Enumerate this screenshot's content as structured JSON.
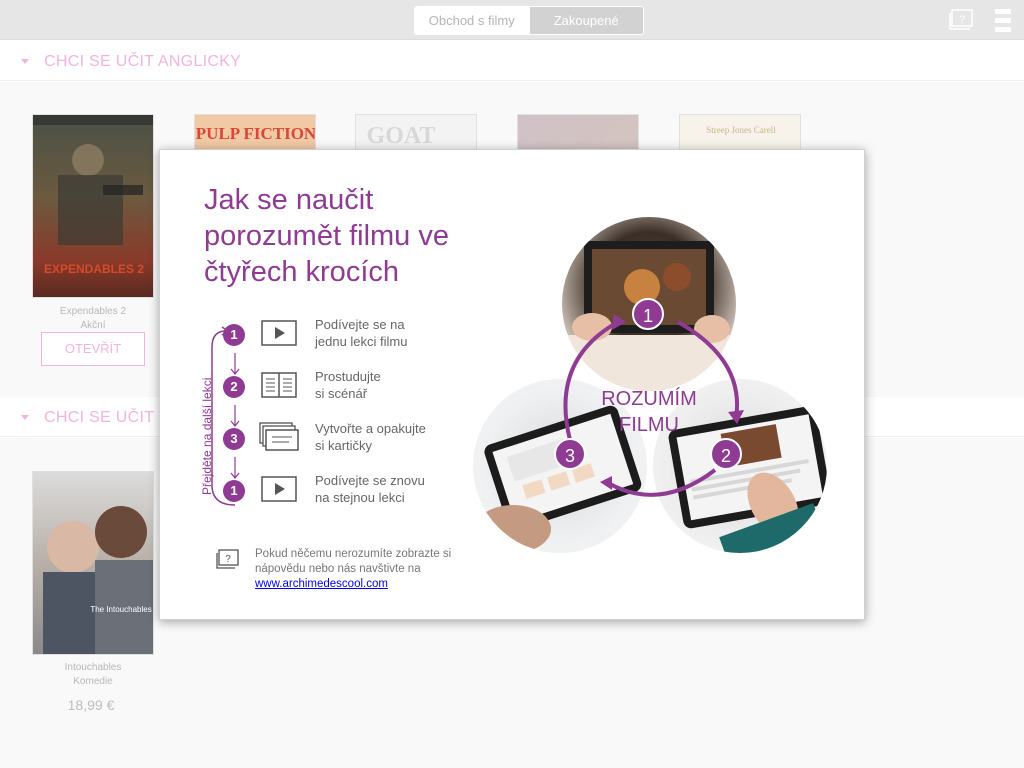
{
  "topbar": {
    "tabs": [
      {
        "label": "Obchod s filmy",
        "active": true
      },
      {
        "label": "Zakoupené",
        "active": false
      }
    ],
    "help_icon": "help-question-icon",
    "menu_icon": "hamburger-menu-icon"
  },
  "sections": [
    {
      "title": "CHCI SE UČIT ANGLICKY"
    },
    {
      "title": "CHCI SE UČIT"
    }
  ],
  "films_row1": [
    {
      "title": "Expendables 2",
      "genre": "Akční",
      "poster_text": "EXPENDABLES 2"
    },
    {
      "poster_text": "PULP FICTION"
    },
    {
      "poster_text": "GOAT"
    },
    {
      "poster_text": ""
    },
    {
      "poster_text": "Streep   Jones   Carell"
    }
  ],
  "open_button": "OTEVŘÍT",
  "films_row2": [
    {
      "title": "Intouchables",
      "genre": "Komedie",
      "price": "18,99 €",
      "poster_text": "The Intouchables"
    }
  ],
  "modal": {
    "title": "Jak se naučit porozumět filmu ve čtyřech krocích",
    "loop_label": "Přejděte na další lekci",
    "steps": [
      {
        "num": "1",
        "icon": "play-icon",
        "text_line1": "Podívejte se na",
        "text_line2": "jednu lekci filmu"
      },
      {
        "num": "2",
        "icon": "script-icon",
        "text_line1": "Prostudujte",
        "text_line2": "si scénář"
      },
      {
        "num": "3",
        "icon": "flashcards-icon",
        "text_line1": "Vytvořte a opakujte",
        "text_line2": "si kartičky"
      },
      {
        "num": "1",
        "icon": "play-icon",
        "text_line1": "Podívejte se znovu",
        "text_line2": "na stejnou lekci"
      }
    ],
    "help_text": "Pokud něčemu nerozumíte zobrazte si nápovědu nebo nás navštivte na",
    "help_link": "www.archimedescool.com",
    "cycle_center_line1": "ROZUMÍM",
    "cycle_center_line2": "FILMU",
    "cycle_numbers": [
      "1",
      "2",
      "3"
    ]
  },
  "colors": {
    "accent": "#8f3b94",
    "accent_light": "#f0b4de",
    "topbar": "#e6e6e6"
  }
}
